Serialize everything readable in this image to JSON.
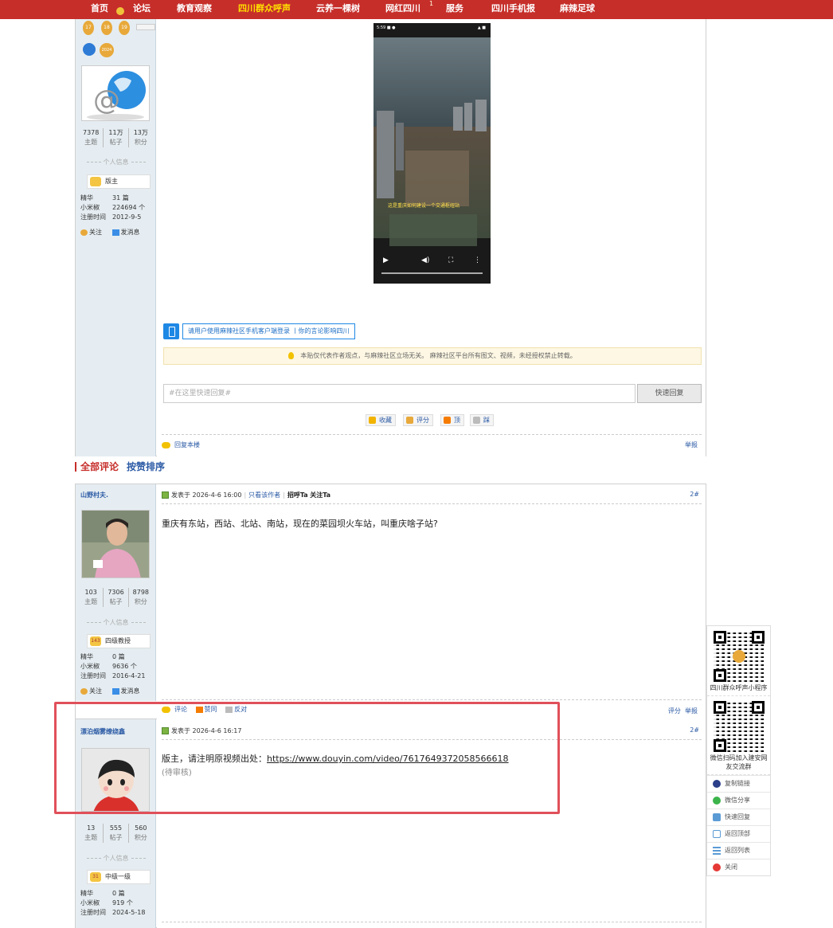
{
  "nav": {
    "items": [
      {
        "label": "首页",
        "highlight": false
      },
      {
        "label": "论坛",
        "highlight": false
      },
      {
        "label": "教育观察",
        "highlight": false
      },
      {
        "label": "四川群众呼声",
        "highlight": true
      },
      {
        "label": "云养一棵树",
        "highlight": false
      },
      {
        "label": "网红四川",
        "highlight": false
      },
      {
        "label": "服务",
        "highlight": false
      },
      {
        "label": "四川手机报",
        "highlight": false
      },
      {
        "label": "麻辣足球",
        "highlight": false
      }
    ],
    "badge": "1"
  },
  "op": {
    "medals": [
      "17",
      "18",
      "19",
      "2024"
    ],
    "stats": [
      {
        "value": "7378",
        "label": "主题"
      },
      {
        "value": "11万",
        "label": "帖子"
      },
      {
        "value": "13万",
        "label": "积分"
      }
    ],
    "section_title": "个人信息",
    "rank": "版主",
    "info": [
      {
        "key": "精华",
        "value": "31 篇"
      },
      {
        "key": "小米椒",
        "value": "224694 个"
      },
      {
        "key": "注册时间",
        "value": "2012-9-5"
      }
    ],
    "follow": "关注",
    "message": "发消息",
    "app_bar": "请用户使用麻辣社区手机客户端登录 丨你的言论影响四川",
    "notice": "本贴仅代表作者观点，与麻辣社区立场无关。 麻辣社区平台所有图文、视频，未经授权禁止转载。",
    "reply_placeholder": "#在这里快速回复#",
    "reply_button": "快速回复",
    "mini_actions": [
      "收藏",
      "评分",
      "顶",
      "踩"
    ],
    "reply_this": "回复本楼",
    "report": "举报",
    "video_caption": "这是重庆如何建设一个交通枢纽站"
  },
  "comments_header": {
    "all": "全部评论",
    "sort": "按赞排序"
  },
  "comment1": {
    "username": "山野村夫.",
    "meta": {
      "posted": "发表于 2026-4-6 16:00",
      "only_author": "只看该作者",
      "greet": "招呼Ta",
      "follow": "关注Ta"
    },
    "floor": "2#",
    "text": "重庆有东站，西站、北站、南站，现在的菜园坝火车站，叫重庆啥子站?",
    "stats": [
      {
        "value": "103",
        "label": "主题"
      },
      {
        "value": "7306",
        "label": "帖子"
      },
      {
        "value": "8798",
        "label": "积分"
      }
    ],
    "section_title": "个人信息",
    "rank": "四级教授",
    "rank_num": "143",
    "info": [
      {
        "key": "精华",
        "value": "0 篇"
      },
      {
        "key": "小米椒",
        "value": "9636 个"
      },
      {
        "key": "注册时间",
        "value": "2016-4-21"
      }
    ],
    "follow": "关注",
    "message": "发消息",
    "actions": [
      "评论",
      "赞同",
      "反对"
    ],
    "rate": "评分",
    "report": "举报"
  },
  "comment2": {
    "username": "漂泊烟雾缭绕鑫",
    "meta": {
      "posted": "发表于 2026-4-6 16:17"
    },
    "floor": "2#",
    "text_prefix": "版主，请注明原视频出处：",
    "link": "https://www.douyin.com/video/7617649372058566618",
    "pending": "(待审核)",
    "stats": [
      {
        "value": "13",
        "label": "主题"
      },
      {
        "value": "555",
        "label": "帖子"
      },
      {
        "value": "560",
        "label": "积分"
      }
    ],
    "section_title": "个人信息",
    "rank": "中级一级",
    "rank_num": "31",
    "info": [
      {
        "key": "精华",
        "value": "0 篇"
      },
      {
        "key": "小米椒",
        "value": "919 个"
      },
      {
        "key": "注册时间",
        "value": "2024-5-18"
      }
    ]
  },
  "sidebar": {
    "qr1_caption": "四川群众呼声小程序",
    "qr2_caption": "微信扫码加入建安网友交流群",
    "items": [
      "复制链接",
      "微信分享",
      "快速回复",
      "返回顶部",
      "返回列表",
      "关闭"
    ]
  },
  "colors": {
    "brand_red": "#c62e2a",
    "link_blue": "#2b5aa5",
    "highlight_red": "#e0505a"
  }
}
